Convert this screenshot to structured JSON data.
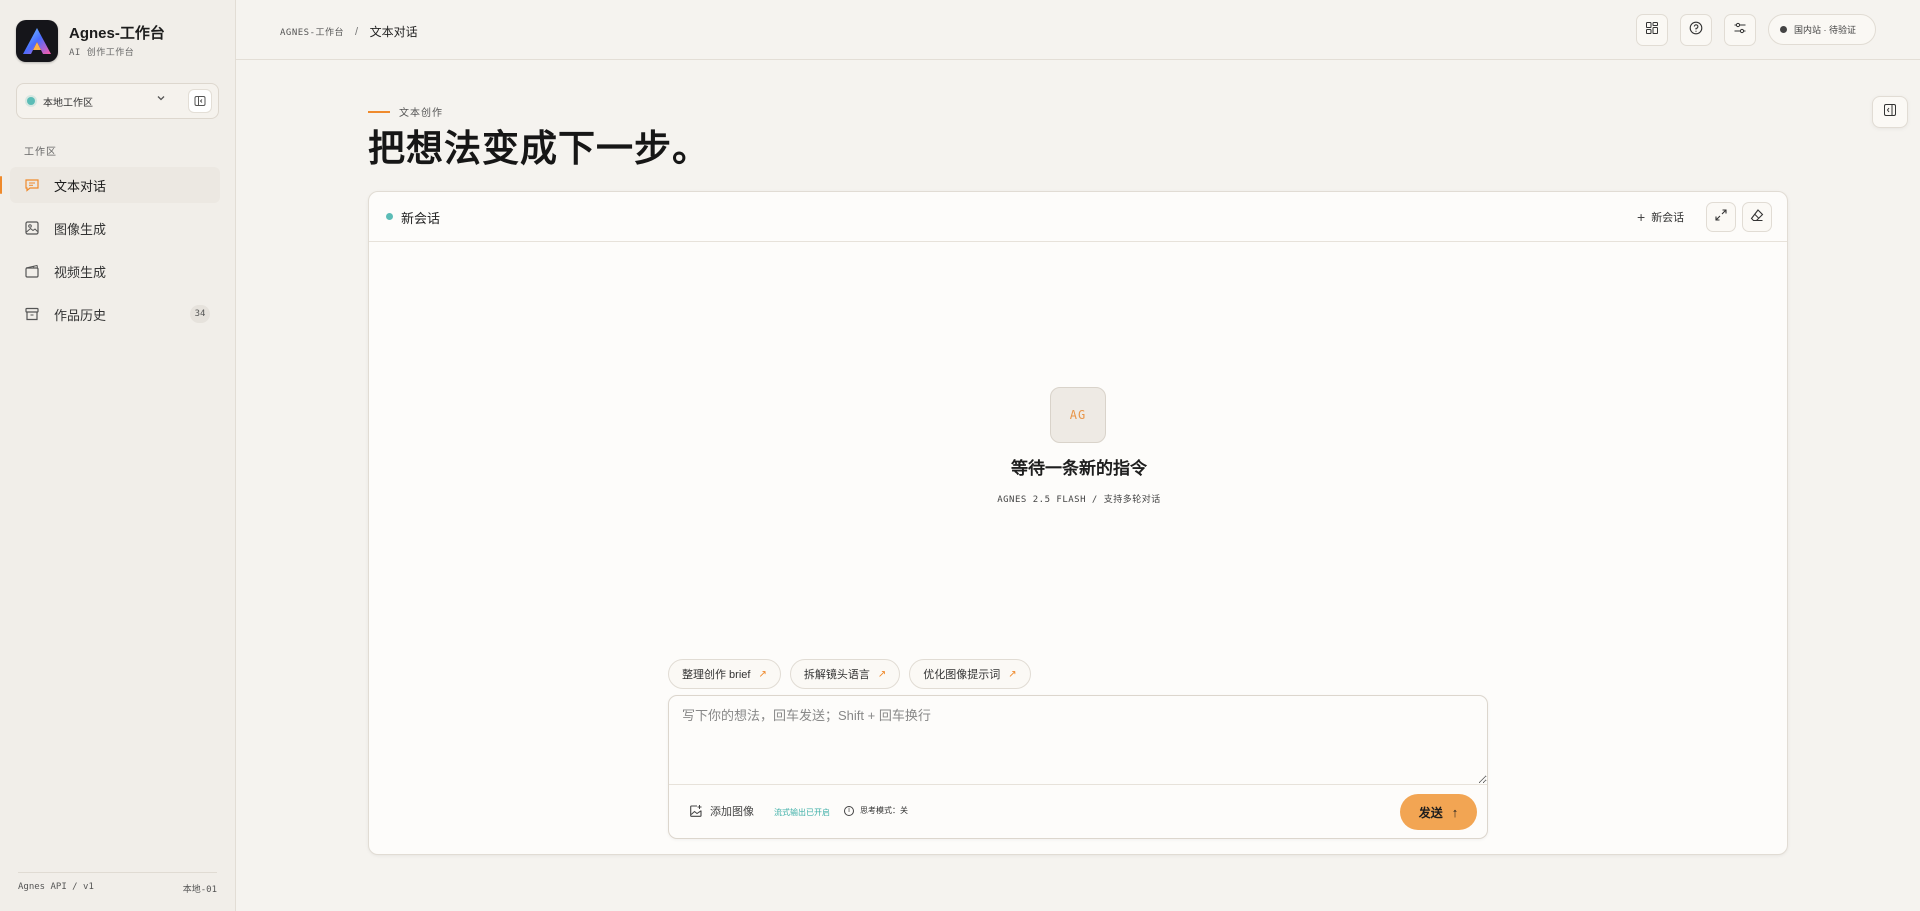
{
  "brand": {
    "title": "Agnes-工作台",
    "subtitle": "AI 创作工作台"
  },
  "workspace": {
    "label": "本地工作区",
    "status_color": "#5bbcb6"
  },
  "sidebar": {
    "section_label": "工作区",
    "items": [
      {
        "label": "文本对话",
        "icon": "chat-icon",
        "active": true
      },
      {
        "label": "图像生成",
        "icon": "image-icon",
        "active": false
      },
      {
        "label": "视频生成",
        "icon": "video-icon",
        "active": false
      },
      {
        "label": "作品历史",
        "icon": "archive-icon",
        "active": false,
        "badge": "34"
      }
    ],
    "footer_left": "Agnes API / v1",
    "footer_right": "本地-01"
  },
  "breadcrumb": {
    "root": "AGNES-工作台",
    "separator": "/",
    "current": "文本对话"
  },
  "topbar": {
    "status": "国内站 · 待验证"
  },
  "hero": {
    "eyebrow": "文本创作",
    "title": "把想法变成下一步。"
  },
  "chat": {
    "session_title": "新会话",
    "new_session_label": "新会话",
    "empty_avatar": "AG",
    "empty_title": "等待一条新的指令",
    "empty_subtitle": "AGNES 2.5 FLASH / 支持多轮对话",
    "chips": [
      "整理创作 brief",
      "拆解镜头语言",
      "优化图像提示词"
    ],
    "input_placeholder": "写下你的想法，回车发送；Shift + 回车换行",
    "add_image_label": "添加图像",
    "stream_status": "流式输出已开启",
    "think_mode": "思考模式：关",
    "send_label": "发送"
  },
  "colors": {
    "accent": "#ef8a2c",
    "send_button": "#f2a553",
    "teal": "#5bbcb6"
  }
}
